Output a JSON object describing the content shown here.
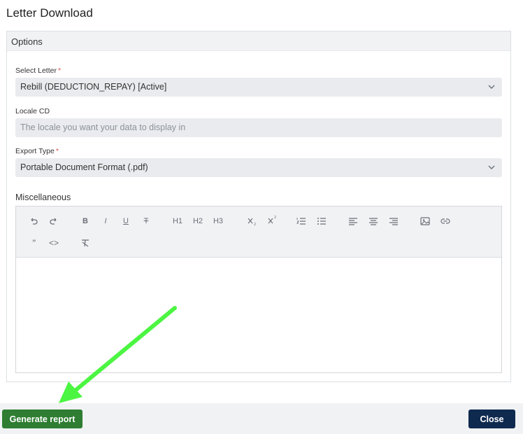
{
  "dialog": {
    "title": "Letter Download"
  },
  "options": {
    "header": "Options",
    "select_letter": {
      "label": "Select Letter",
      "required_mark": "*",
      "value": "Rebill (DEDUCTION_REPAY) [Active]"
    },
    "locale_cd": {
      "label": "Locale CD",
      "placeholder": "The locale you want your data to display in"
    },
    "export_type": {
      "label": "Export Type",
      "required_mark": "*",
      "value": "Portable Document Format (.pdf)"
    },
    "misc": {
      "label": "Miscellaneous",
      "toolbar": {
        "h1": "H1",
        "h2": "H2",
        "h3": "H3",
        "bold": "B",
        "italic": "I",
        "underline": "U",
        "strike": "T",
        "quote": "”",
        "code": "<>"
      }
    }
  },
  "footer": {
    "generate_label": "Generate report",
    "close_label": "Close"
  },
  "colors": {
    "generate": "#2e7d32",
    "close": "#0f2a4f",
    "arrow": "#4cf542"
  }
}
